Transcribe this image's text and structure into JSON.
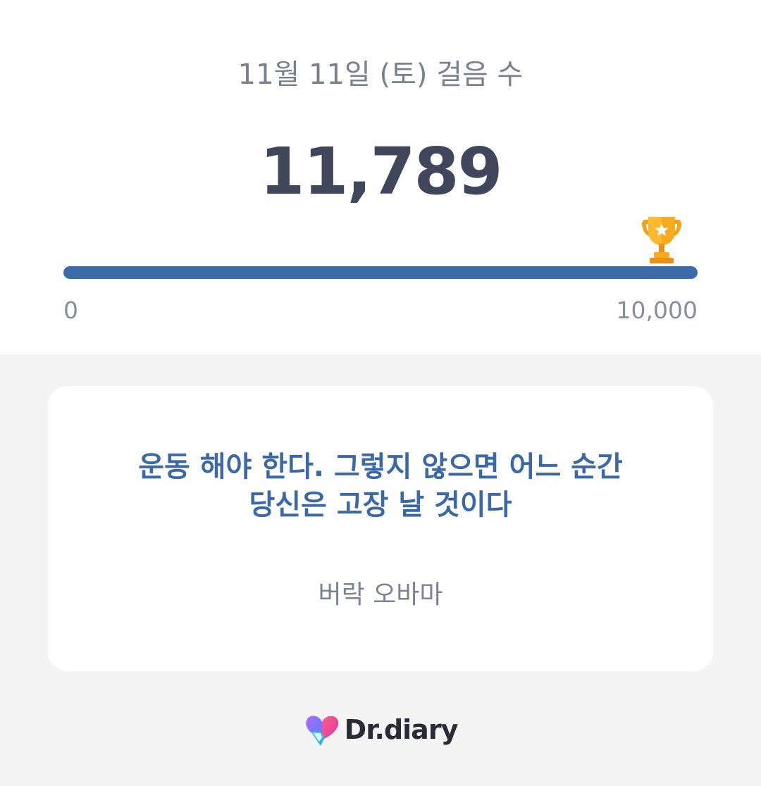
{
  "header": {
    "date_title": "11월 11일 (토) 걸음 수",
    "step_count": "11,789"
  },
  "progress": {
    "min_label": "0",
    "max_label": "10,000",
    "fill_fraction": 1.0,
    "trophy_icon": "trophy-icon",
    "fill_color": "#3d6aa8"
  },
  "quote": {
    "text": "운동 해야 한다. 그렇지 않으면 어느 순간\n당신은 고장 날 것이다",
    "author": "버락 오바마",
    "text_color": "#3c69a6"
  },
  "brand": {
    "name": "Dr.diary",
    "logo_icon": "heart-logo-icon"
  }
}
